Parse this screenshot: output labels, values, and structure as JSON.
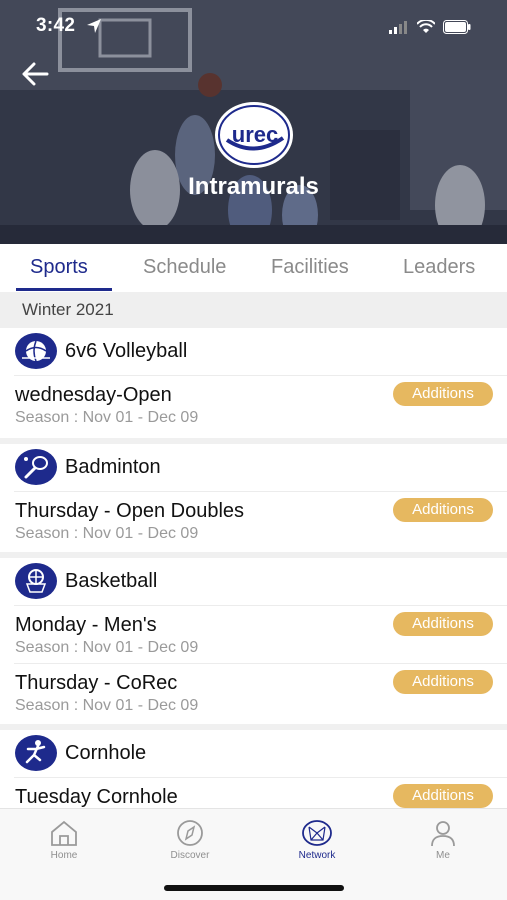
{
  "status_bar": {
    "time": "3:42"
  },
  "header": {
    "title": "Intramurals",
    "logo_text": "urec"
  },
  "tabs": [
    {
      "label": "Sports",
      "active": true
    },
    {
      "label": "Schedule",
      "active": false
    },
    {
      "label": "Facilities",
      "active": false
    },
    {
      "label": "Leaders",
      "active": false
    }
  ],
  "season": {
    "label": "Winter 2021"
  },
  "sports": [
    {
      "name": "6v6 Volleyball",
      "icon": "volleyball-icon",
      "leagues": [
        {
          "name": "wednesday-Open",
          "season": "Season : Nov 01 - Dec 09",
          "button": "Additions"
        }
      ]
    },
    {
      "name": "Badminton",
      "icon": "badminton-icon",
      "leagues": [
        {
          "name": "Thursday - Open Doubles",
          "season": "Season : Nov 01 - Dec 09",
          "button": "Additions"
        }
      ]
    },
    {
      "name": "Basketball",
      "icon": "basketball-icon",
      "leagues": [
        {
          "name": "Monday - Men's",
          "season": "Season : Nov 01 - Dec 09",
          "button": "Additions"
        },
        {
          "name": "Thursday - CoRec",
          "season": "Season : Nov 01 - Dec 09",
          "button": "Additions"
        }
      ]
    },
    {
      "name": "Cornhole",
      "icon": "cornhole-icon",
      "leagues": [
        {
          "name": "Tuesday Cornhole",
          "season": "",
          "button": "Additions"
        }
      ]
    }
  ],
  "bottom_nav": [
    {
      "label": "Home",
      "icon": "home-icon",
      "active": false
    },
    {
      "label": "Discover",
      "icon": "compass-icon",
      "active": false
    },
    {
      "label": "Network",
      "icon": "network-icon",
      "active": true
    },
    {
      "label": "Me",
      "icon": "person-icon",
      "active": false
    }
  ],
  "colors": {
    "accent": "#1e2a8c",
    "button": "#e6b860",
    "muted_text": "#9a9a9a"
  }
}
